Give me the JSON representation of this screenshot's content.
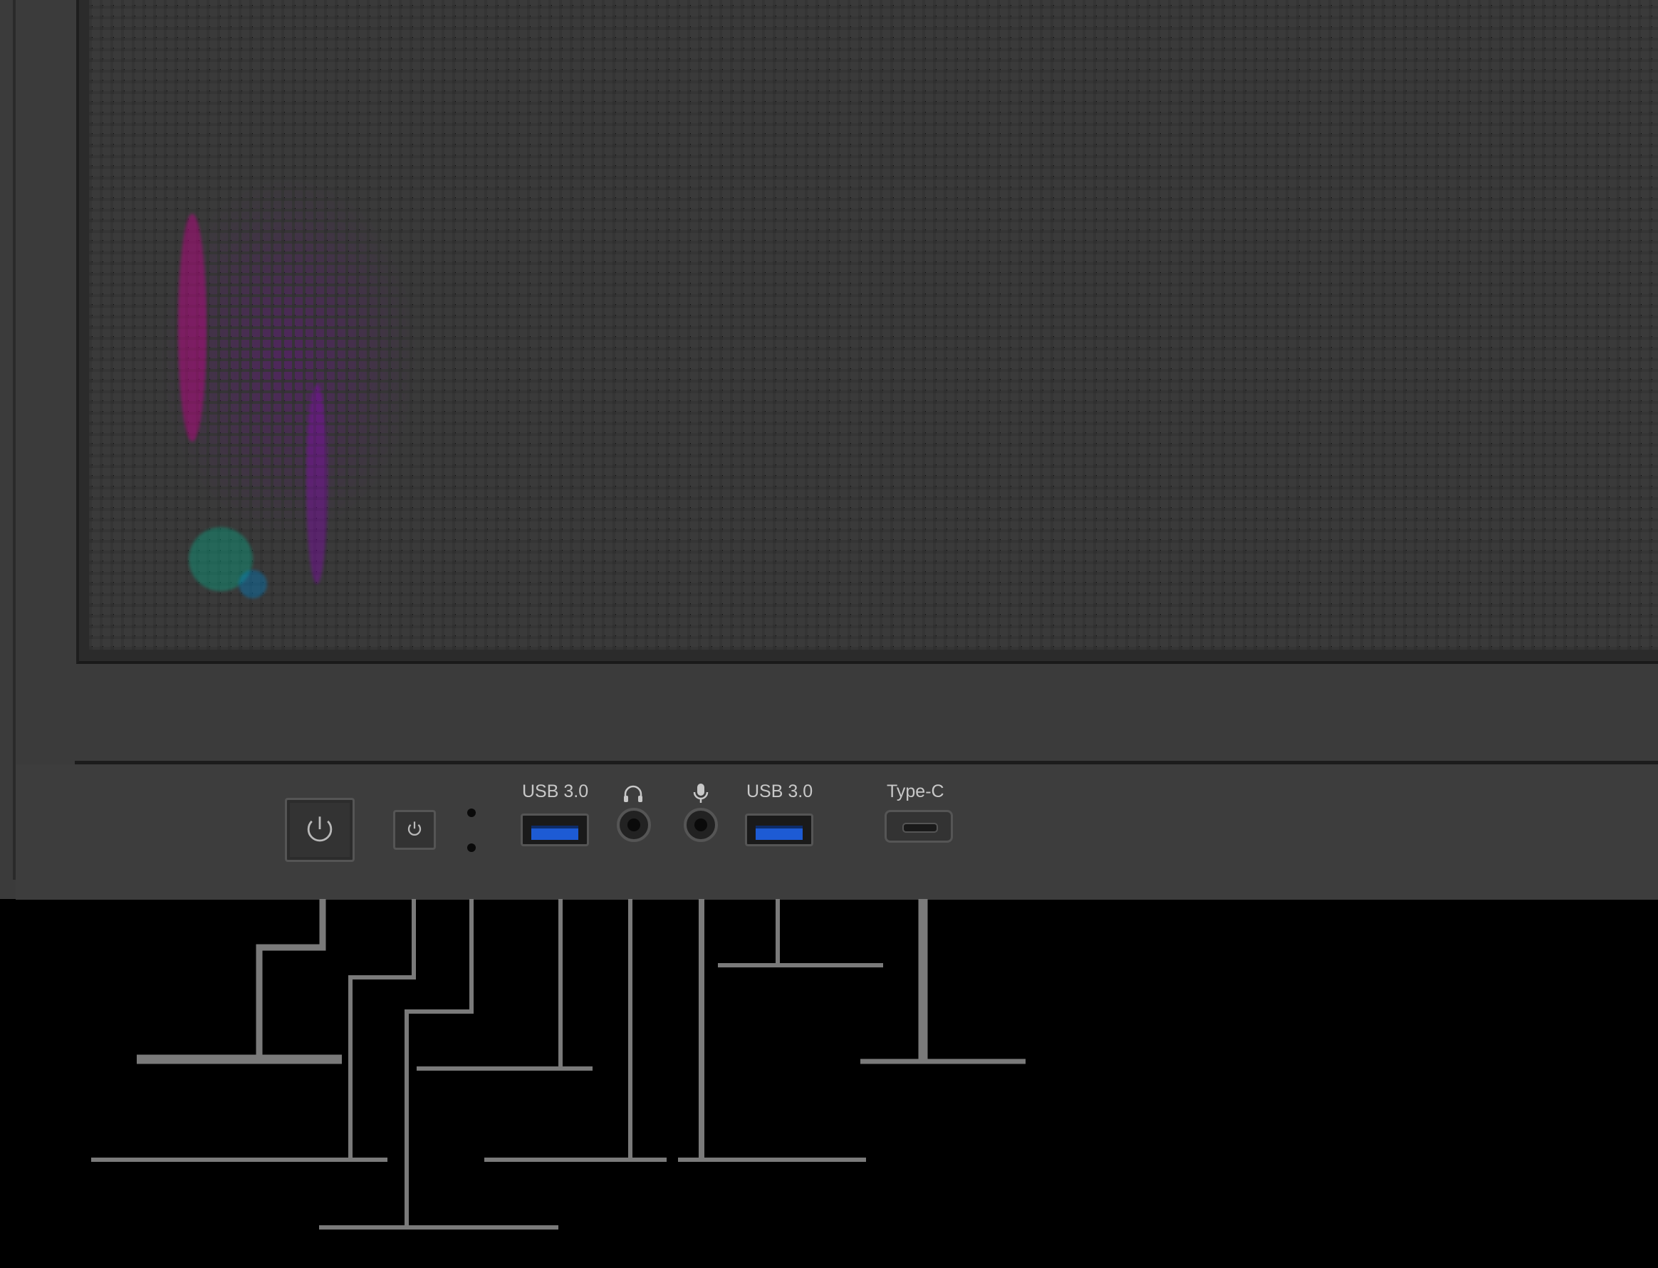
{
  "io_panel": {
    "usb_left_label": "USB 3.0",
    "usb_right_label": "USB 3.0",
    "typec_label": "Type-C"
  },
  "icons": {
    "power": "power-icon",
    "reset": "reset-icon",
    "headphone": "headphone-icon",
    "microphone": "microphone-icon"
  },
  "colors": {
    "case": "#3b3b3b",
    "background": "#000000",
    "usb_blue": "#1d5bd4",
    "leader_lines": "#7a7a7a",
    "label_text": "#c8c8c8"
  }
}
